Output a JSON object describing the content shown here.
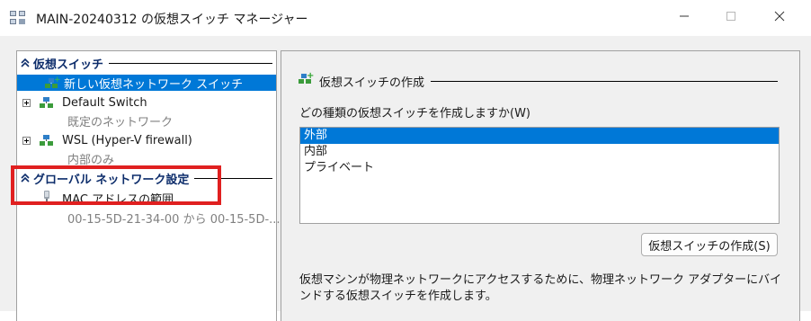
{
  "window": {
    "title": "MAIN-20240312 の仮想スイッチ マネージャー",
    "icon": "virtual-switch-manager-icon",
    "controls": [
      "minimize-icon",
      "maximize-icon",
      "close-icon"
    ]
  },
  "left_pane": {
    "section_virtual_switches": {
      "label": "仮想スイッチ",
      "items": [
        {
          "label": "新しい仮想ネットワーク スイッチ",
          "selected": true,
          "icon": "new-switch-icon"
        },
        {
          "label": "Default Switch",
          "sub": "既定のネットワーク",
          "icon": "network-switch-icon"
        },
        {
          "label": "WSL (Hyper-V firewall)",
          "sub": "内部のみ",
          "icon": "network-switch-icon"
        }
      ]
    },
    "section_global": {
      "label": "グローバル ネットワーク設定",
      "items": [
        {
          "label": "MAC アドレスの範囲",
          "sub": "00-15-5D-21-34-00 から 00-15-5D-...",
          "icon": "mac-address-icon"
        }
      ]
    }
  },
  "right_pane": {
    "title": "仮想スイッチの作成",
    "question": "どの種類の仮想スイッチを作成しますか(W)",
    "types": [
      "外部",
      "内部",
      "プライベート"
    ],
    "selected_type": "外部",
    "create_button": "仮想スイッチの作成(S)",
    "description": "仮想マシンが物理ネットワークにアクセスするために、物理ネットワーク アダプターにバインドする仮想スイッチを作成します。"
  },
  "colors": {
    "selection": "#0078d7",
    "section_header": "#0d2d6b",
    "highlight_box": "#e02020"
  }
}
